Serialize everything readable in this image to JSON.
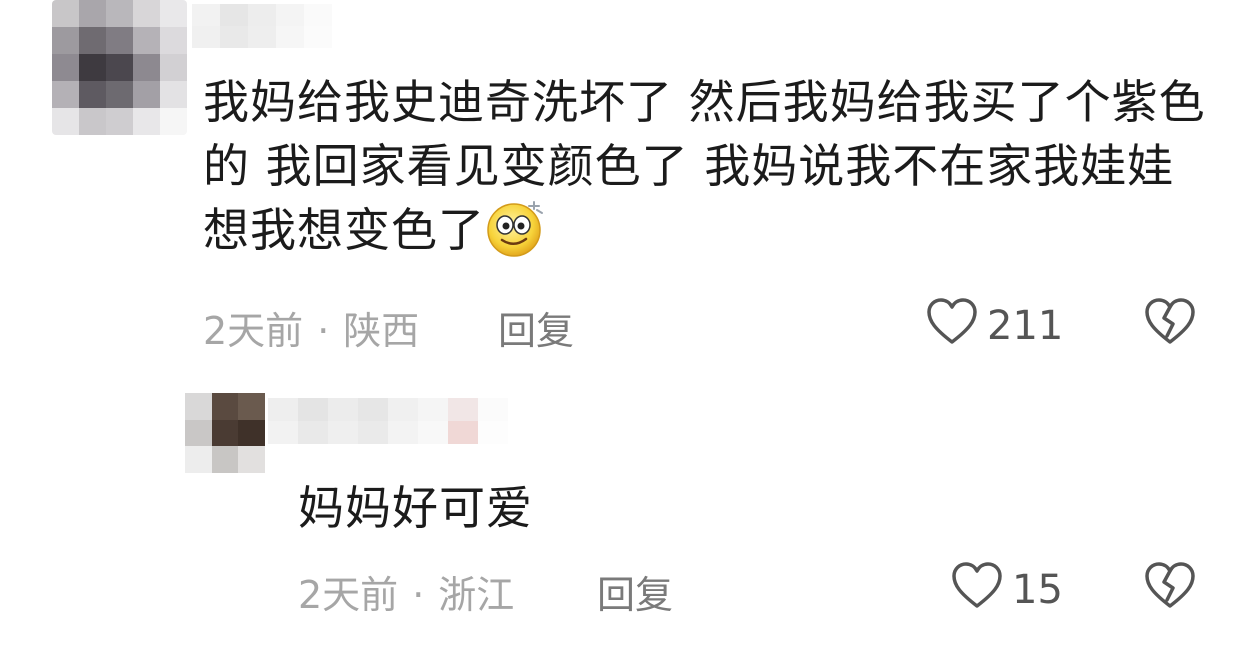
{
  "comment": {
    "text": "我妈给我史迪奇洗坏了 然后我妈给我买了个紫色的 我回家看见变颜色了 我妈说我不在家我娃娃想我想变色了",
    "emoji": "dizzy-smile-emoji",
    "time": "2天前",
    "separator": "·",
    "location": "陕西",
    "reply_label": "回复",
    "like_count": "211"
  },
  "reply": {
    "text": "妈妈好可爱",
    "time": "2天前",
    "separator": "·",
    "location": "浙江",
    "reply_label": "回复",
    "like_count": "15"
  },
  "icons": {
    "like": "heart-outline-icon",
    "dislike": "broken-heart-icon"
  },
  "colors": {
    "text": "#1b1b1b",
    "meta": "#a6a6a6",
    "icon": "#555555"
  }
}
